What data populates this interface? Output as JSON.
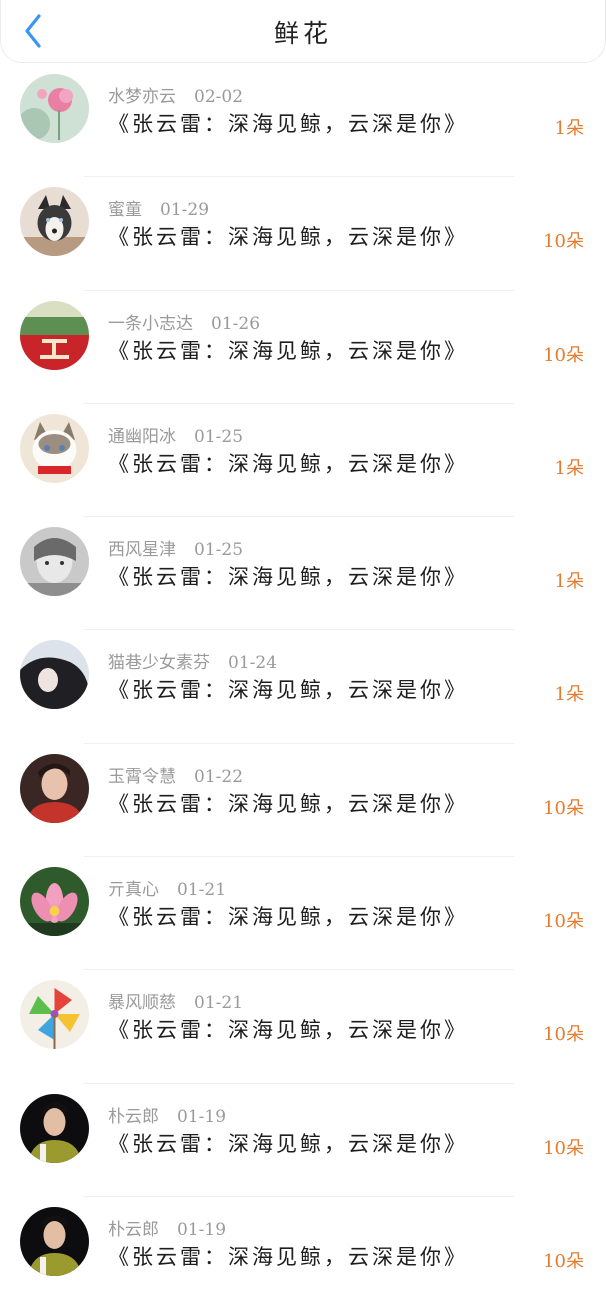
{
  "header": {
    "title": "鲜花",
    "back_icon": "chevron-left-icon",
    "accent_color": "#3a96f0"
  },
  "count_color": "#e47b2e",
  "items": [
    {
      "user": "水梦亦云",
      "date": "02-02",
      "message": "《张云雷：深海见鲸，云深是你》",
      "count": "1朵"
    },
    {
      "user": "蜜童",
      "date": "01-29",
      "message": "《张云雷：深海见鲸，云深是你》",
      "count": "10朵"
    },
    {
      "user": "一条小志达",
      "date": "01-26",
      "message": "《张云雷：深海见鲸，云深是你》",
      "count": "10朵"
    },
    {
      "user": "通幽阳冰",
      "date": "01-25",
      "message": "《张云雷：深海见鲸，云深是你》",
      "count": "1朵"
    },
    {
      "user": "西风星津",
      "date": "01-25",
      "message": "《张云雷：深海见鲸，云深是你》",
      "count": "1朵"
    },
    {
      "user": "猫巷少女素芬",
      "date": "01-24",
      "message": "《张云雷：深海见鲸，云深是你》",
      "count": "1朵"
    },
    {
      "user": "玉霄令慧",
      "date": "01-22",
      "message": "《张云雷：深海见鲸，云深是你》",
      "count": "10朵"
    },
    {
      "user": "亓真心",
      "date": "01-21",
      "message": "《张云雷：深海见鲸，云深是你》",
      "count": "10朵"
    },
    {
      "user": "暴风顺慈",
      "date": "01-21",
      "message": "《张云雷：深海见鲸，云深是你》",
      "count": "10朵"
    },
    {
      "user": "朴云郎",
      "date": "01-19",
      "message": "《张云雷：深海见鲸，云深是你》",
      "count": "10朵"
    },
    {
      "user": "朴云郎",
      "date": "01-19",
      "message": "《张云雷：深海见鲸，云深是你》",
      "count": "10朵"
    }
  ]
}
